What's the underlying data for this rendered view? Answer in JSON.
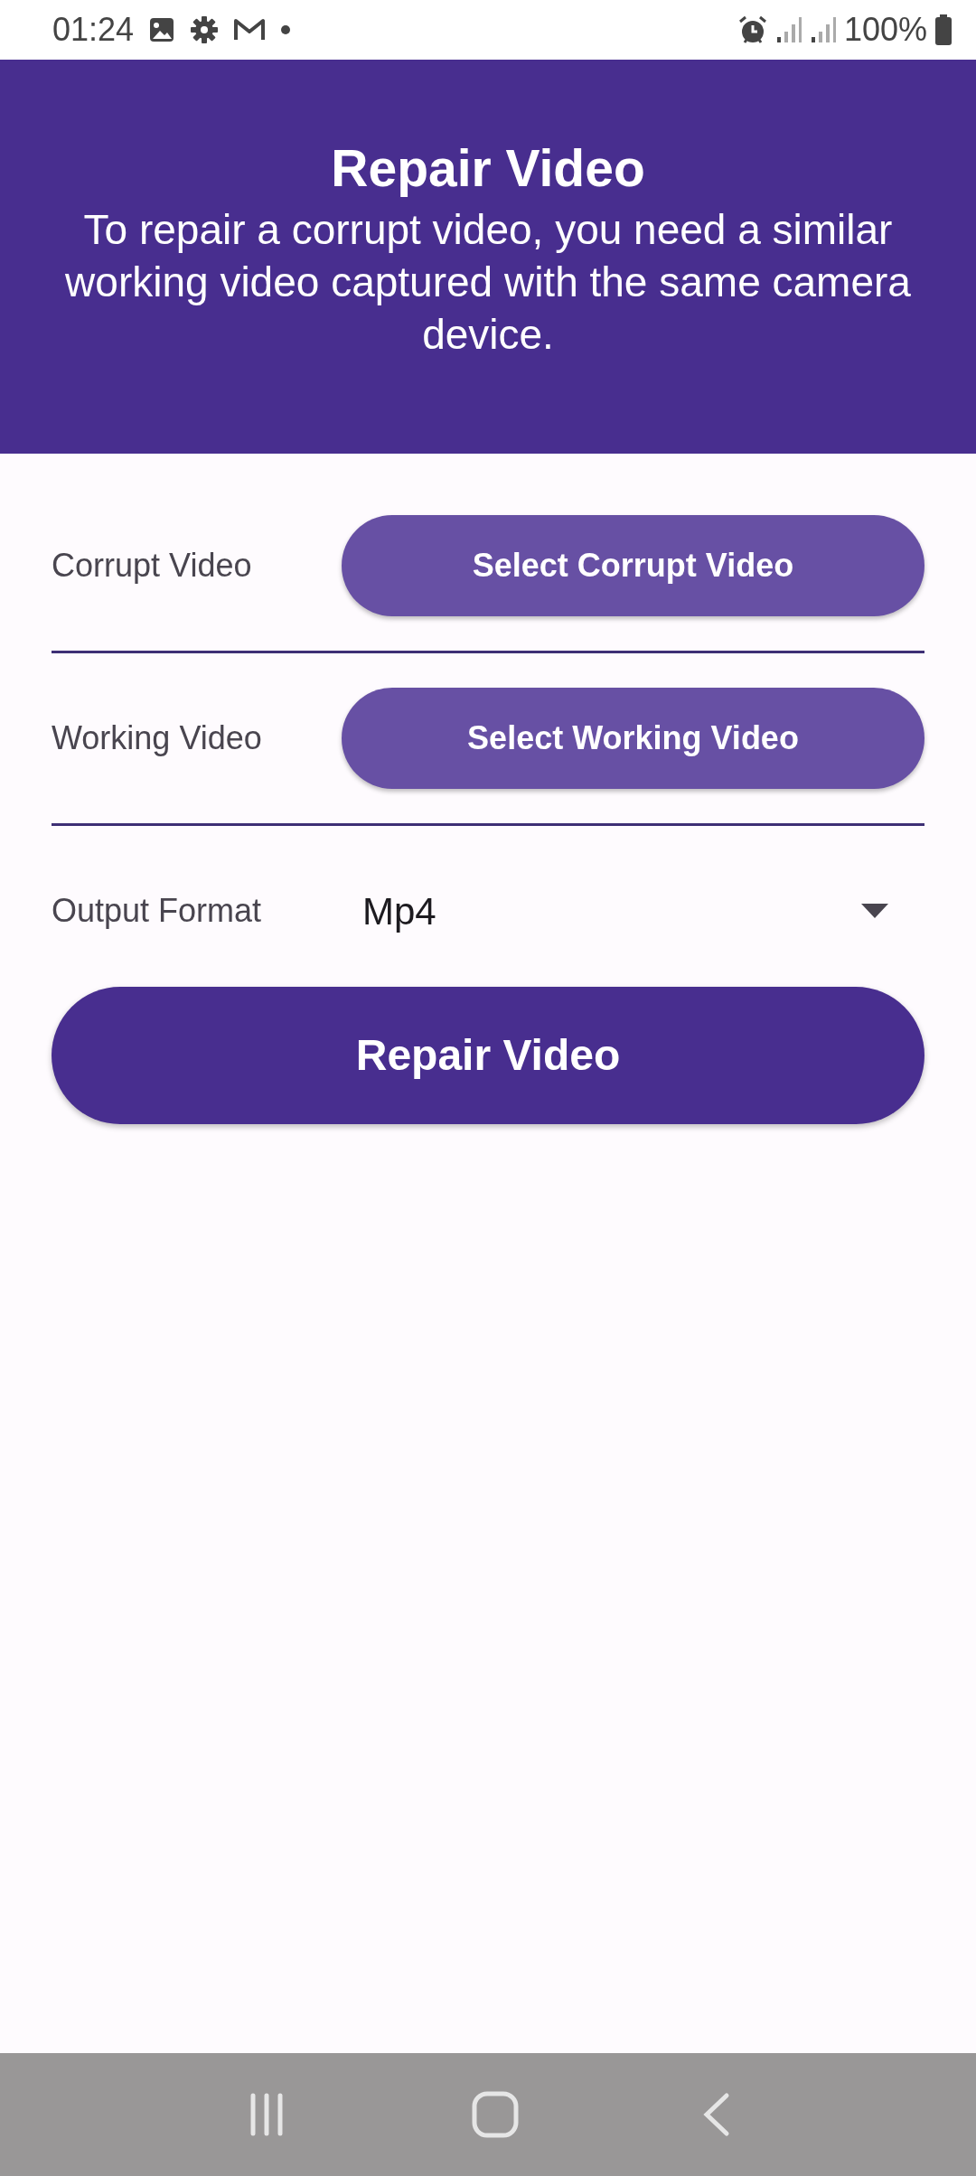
{
  "status_bar": {
    "time": "01:24",
    "battery": "100%"
  },
  "header": {
    "title": "Repair Video",
    "description": "To repair a corrupt video, you need a similar working video captured with the same camera device."
  },
  "rows": [
    {
      "kind": "button",
      "label": "Corrupt Video",
      "button": "Select Corrupt Video"
    },
    {
      "kind": "button",
      "label": "Working Video",
      "button": "Select Working Video"
    },
    {
      "kind": "select",
      "label": "Output Format",
      "value": "Mp4"
    }
  ],
  "action_button": "Repair Video"
}
